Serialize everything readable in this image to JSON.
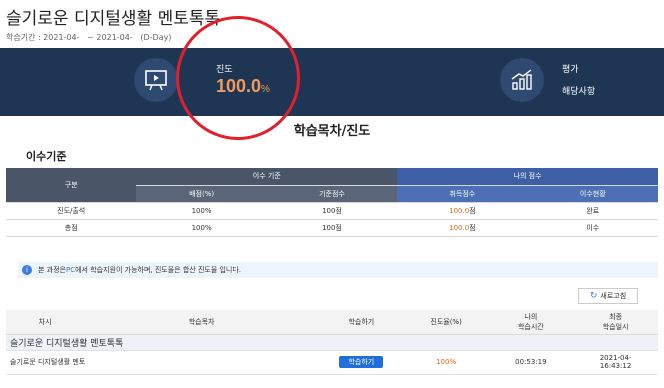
{
  "header": {
    "course_title": "슬기로운 디지털생활 멘토톡톡",
    "period_label": "학습기간 : 2021-04-",
    "period_start_tail": "   ~ 2021-04-",
    "period_end_tail": "   (D-Day)"
  },
  "banner": {
    "progress_label": "진도",
    "progress_value": "100.0",
    "progress_unit": "%",
    "eval_label": "평가",
    "eval_value": "해당사항",
    "icons": [
      "presentation-icon",
      "growth-chart-icon"
    ]
  },
  "section_title": "학습목차/진도",
  "criteria": {
    "title": "이수기준",
    "header": {
      "col_group": "구분",
      "completion_criteria": "이수 기준",
      "my_score": "나의 점수",
      "weight": "배점(%)",
      "base_score": "기준점수",
      "obtained": "취득점수",
      "status": "이수현황"
    },
    "rows": [
      {
        "name": "진도/출석",
        "weight": "100%",
        "base": "100점",
        "obtained": "100.0",
        "obtained_unit": "점",
        "status": "완료"
      },
      {
        "name": "총점",
        "weight": "100%",
        "base": "100점",
        "obtained": "100.0",
        "obtained_unit": "점",
        "status": "이수"
      }
    ]
  },
  "notice": {
    "prefix": "본 과정은 ",
    "pc": "PC",
    "suffix": " 에서 학습지원이 가능하며, 진도율은 합산 진도율 입니다."
  },
  "refresh_label": "새로고침",
  "list": {
    "headers": [
      "차시",
      "학습목차",
      "학습하기",
      "진도율(%)",
      "나의\n학습시간",
      "최종\n학습일시"
    ],
    "header_col5_line1": "나의",
    "header_col5_line2": "학습시간",
    "header_col6_line1": "최종",
    "header_col6_line2": "학습일시",
    "group_title": "슬기로운 디지털생활 멘토톡톡",
    "rows": [
      {
        "title": "슬기로운 디지털생활 멘토",
        "button": "학습하기",
        "progress": "100%",
        "time": "00:53:19",
        "date": "2021-04-",
        "time2": "16:43:12"
      }
    ]
  },
  "colors": {
    "banner_bg": "#1f3554",
    "accent_orange": "#f29a5a",
    "annotation_red": "#e0202a",
    "button_blue": "#1e6fd9"
  }
}
